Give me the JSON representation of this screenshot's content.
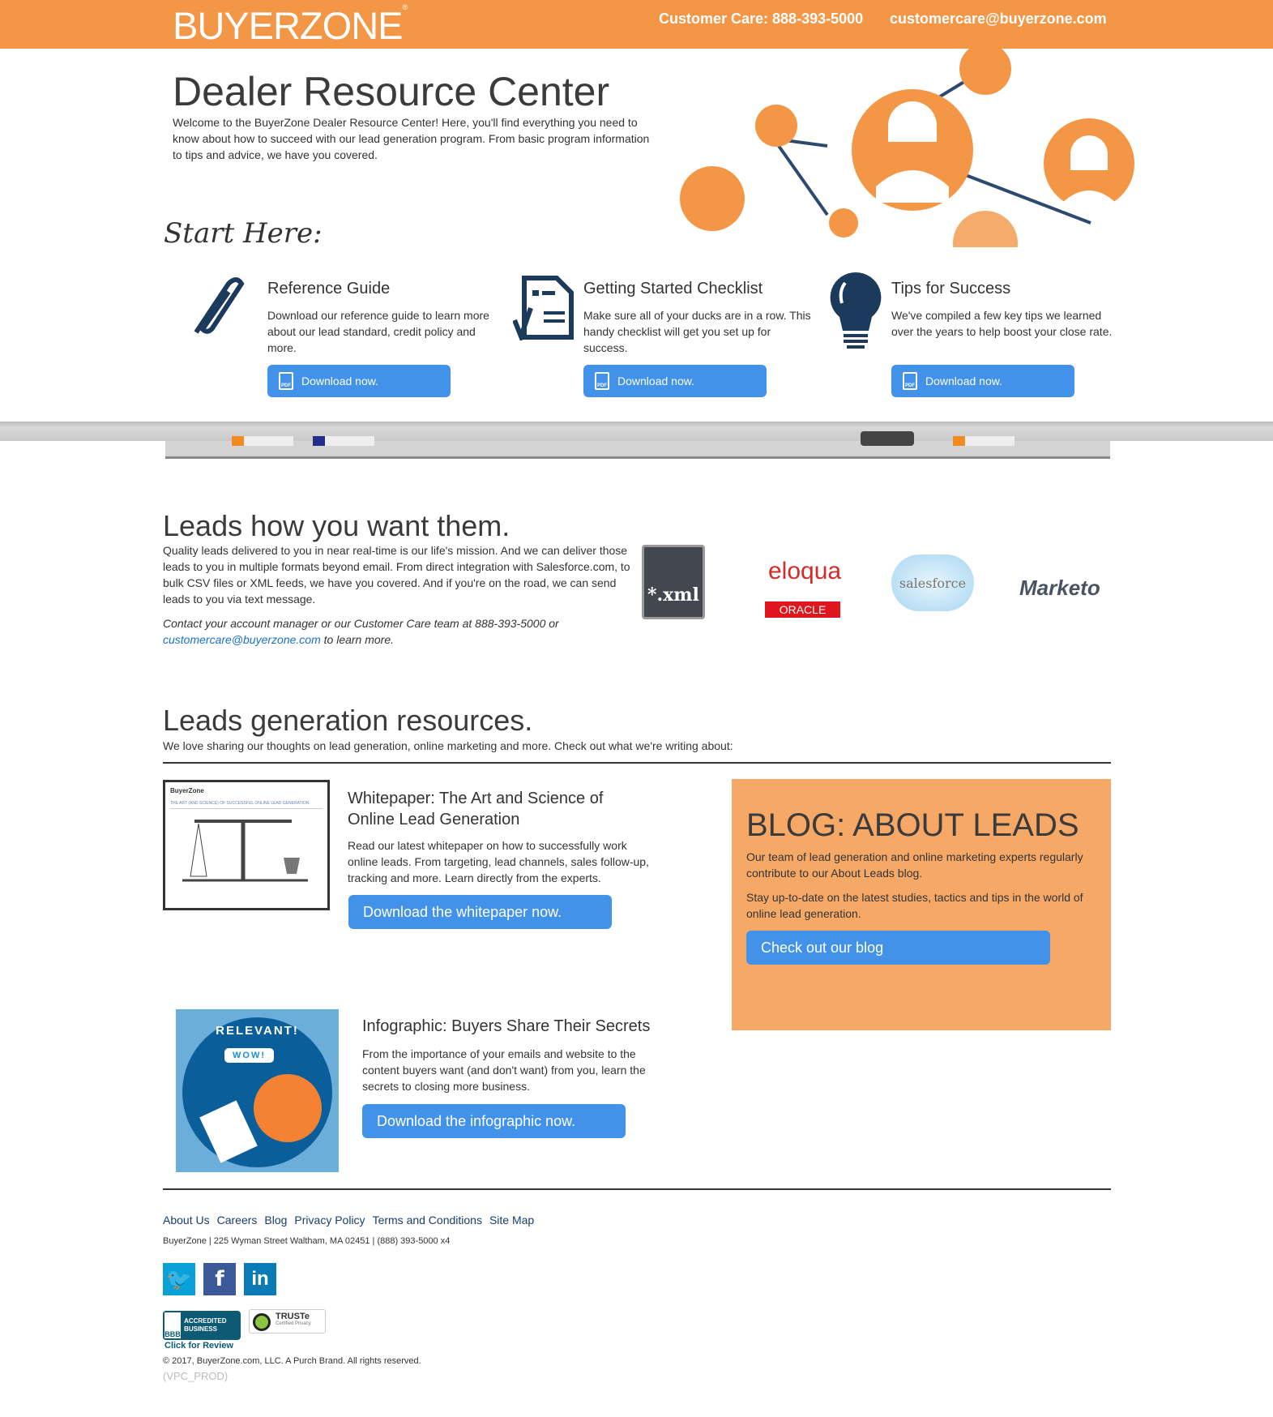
{
  "header": {
    "logo": "BUYERZONE",
    "phone": "Customer Care: 888-393-5000",
    "email": "customercare@buyerzone.com"
  },
  "hero": {
    "title": "Dealer Resource Center",
    "intro": "Welcome to the BuyerZone Dealer Resource Center! Here, you'll find everything you need to know about how to succeed with our lead generation program. From basic program information to tips and advice, we have you covered."
  },
  "start": {
    "heading": "Start Here:",
    "items": [
      {
        "title": "Reference Guide",
        "desc": "Download our reference guide to learn more about our lead standard, credit policy and more.",
        "button": "Download now."
      },
      {
        "title": "Getting Started Checklist",
        "desc": "Make sure all of your ducks are in a row. This handy checklist will get you set up for success.",
        "button": "Download now."
      },
      {
        "title": "Tips for Success",
        "desc": "We've compiled a few key tips we learned over the years to help boost your close rate.",
        "button": "Download now."
      }
    ]
  },
  "leads": {
    "heading": "Leads how you want them.",
    "body": "Quality leads delivered to you in near real-time is our life's mission. And we can deliver those leads to you in multiple formats beyond email. From direct integration with Salesforce.com, to bulk CSV files or XML feeds, we have you covered. And if you're on the road, we can send leads to you via text message.",
    "contact": "Contact your account manager or our Customer Care team at 888-393-5000 or",
    "contact_email": "customercare@buyerzone.com",
    "contact_end": " to learn more.",
    "logos": {
      "xml": "*.xml",
      "eloqua": "eloqua",
      "oracle": "ORACLE",
      "salesforce": "salesforce",
      "marketo": "Marketo"
    }
  },
  "resources": {
    "heading": "Leads generation resources.",
    "sub": "We love sharing our thoughts on lead generation, online marketing and more. Check out what we're writing about:",
    "whitepaper": {
      "thumb_brand": "BuyerZone",
      "thumb_title": "THE ART (AND SCIENCE) OF SUCCESSFUL ONLINE LEAD GENERATION",
      "title": "Whitepaper: The Art and Science of Online Lead Generation",
      "desc": "Read our latest whitepaper on how to successfully work online leads. From targeting, lead channels, sales follow-up, tracking and more. Learn directly from the experts.",
      "button": "Download the whitepaper now."
    },
    "infographic": {
      "thumb_top": "RELEVANT!",
      "thumb_bubble": "WOW!",
      "title": "Infographic: Buyers Share Their Secrets",
      "desc": "From the importance of your emails and website to the content buyers want (and don't want) from you, learn the secrets to closing more business.",
      "button": "Download the infographic now."
    },
    "blog": {
      "title": "BLOG: ABOUT LEADS",
      "p1": "Our team of lead generation and online marketing experts regularly contribute to our About Leads blog.",
      "p2": "Stay up-to-date on the latest studies, tactics and tips in the world of online lead generation.",
      "button": "Check out our blog"
    }
  },
  "footer": {
    "links": [
      "About Us",
      "Careers",
      "Blog",
      "Privacy Policy",
      "Terms and Conditions",
      "Site Map"
    ],
    "address": "BuyerZone | 225 Wyman Street Waltham, MA 02451 | (888) 393-5000 x4",
    "bbb": "ACCREDITED BUSINESS",
    "bbb_review": "Click for Review",
    "truste": "TRUSTe",
    "truste_sub": "Certified Privacy",
    "copyright": "© 2017, BuyerZone.com, LLC. A Purch Brand. All rights reserved.",
    "env": "(VPC_PROD)"
  },
  "colors": {
    "orange": "#F39646",
    "button": "#4192E8",
    "navy": "#1B3A5C"
  }
}
